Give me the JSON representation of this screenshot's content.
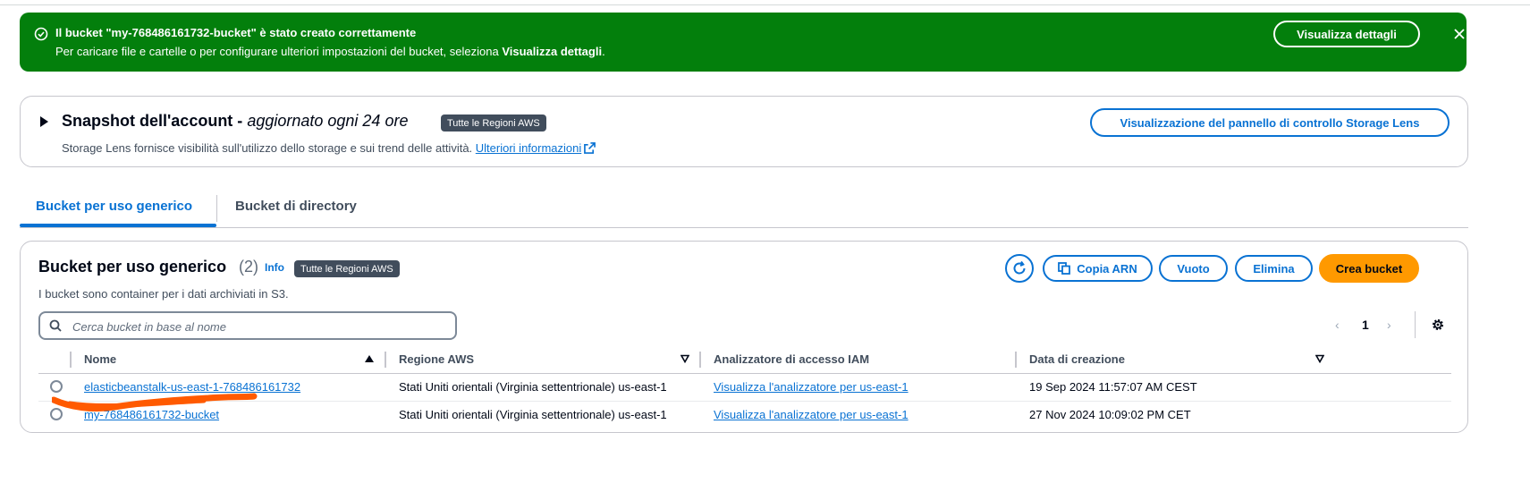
{
  "flash": {
    "title": "Il bucket \"my-768486161732-bucket\" è stato creato correttamente",
    "message_prefix": "Per caricare file e cartelle o per configurare ulteriori impostazioni del bucket, seleziona ",
    "message_bold": "Visualizza dettagli",
    "message_suffix": ".",
    "details_button": "Visualizza dettagli",
    "color": "#037f0c"
  },
  "snapshot": {
    "title": "Snapshot dell'account - ",
    "title_italic": "aggiornato ogni 24 ore",
    "badge": "Tutte le Regioni AWS",
    "description": "Storage Lens fornisce visibilità sull'utilizzo dello storage e sui trend delle attività. ",
    "more_info_link": "Ulteriori informazioni",
    "lens_button": "Visualizzazione del pannello di controllo Storage Lens"
  },
  "tabs": [
    {
      "label": "Bucket per uso generico",
      "active": true
    },
    {
      "label": "Bucket di directory",
      "active": false
    }
  ],
  "buckets_panel": {
    "title": "Bucket per uso generico",
    "count": "(2)",
    "info_link": "Info",
    "badge": "Tutte le Regioni AWS",
    "subtitle": "I bucket sono container per i dati archiviati in S3.",
    "buttons": {
      "copy_arn": "Copia ARN",
      "empty": "Vuoto",
      "delete": "Elimina",
      "create": "Crea bucket"
    },
    "search_placeholder": "Cerca bucket in base al nome",
    "pagination": {
      "prev": "‹",
      "page": "1",
      "next": "›"
    },
    "columns": [
      "Nome",
      "Regione AWS",
      "Analizzatore di accesso IAM",
      "Data di creazione"
    ],
    "rows": [
      {
        "name": "elasticbeanstalk-us-east-1-768486161732",
        "region": "Stati Uniti orientali (Virginia settentrionale) us-east-1",
        "iam": "Visualizza l'analizzatore per us-east-1",
        "created": "19 Sep 2024 11:57:07 AM CEST"
      },
      {
        "name": "my-768486161732-bucket",
        "region": "Stati Uniti orientali (Virginia settentrionale) us-east-1",
        "iam": "Visualizza l'analizzatore per us-east-1",
        "created": "27 Nov 2024 10:09:02 PM CET"
      }
    ]
  },
  "colors": {
    "accent": "#0972d3",
    "primary_button": "#ff9900",
    "annotation_scribble": "#ff5a00"
  }
}
